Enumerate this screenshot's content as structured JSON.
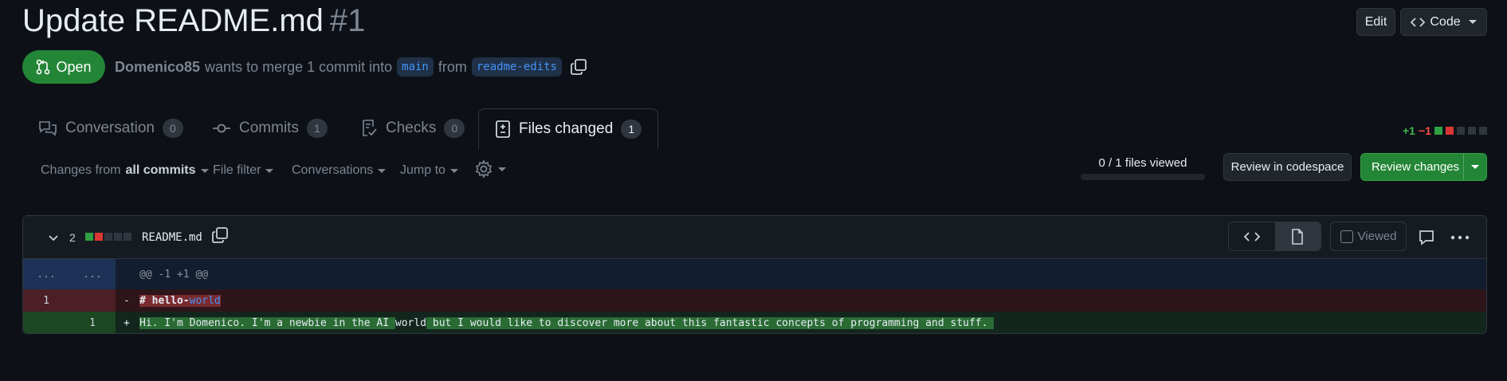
{
  "pr": {
    "title": "Update README.md",
    "number": "#1",
    "status": "Open",
    "author": "Domenico85",
    "merge_text": "wants to merge 1 commit into",
    "base_branch": "main",
    "from_text": "from",
    "head_branch": "readme-edits"
  },
  "header_buttons": {
    "edit": "Edit",
    "code": "Code"
  },
  "tabs": [
    {
      "label": "Conversation",
      "count": "0"
    },
    {
      "label": "Commits",
      "count": "1"
    },
    {
      "label": "Checks",
      "count": "0"
    },
    {
      "label": "Files changed",
      "count": "1"
    }
  ],
  "diffstat": {
    "additions": "+1",
    "deletions": "−1"
  },
  "toolbar": {
    "changes_from": "Changes from",
    "all_commits": "all commits",
    "file_filter": "File filter",
    "conversations": "Conversations",
    "jump_to": "Jump to",
    "files_viewed": "0 / 1 files viewed",
    "review_codespace": "Review in codespace",
    "review_changes": "Review changes"
  },
  "file": {
    "changes_count": "2",
    "name": "README.md",
    "viewed_label": "Viewed",
    "hunk_ln": "...",
    "hunk_header": "@@ -1 +1 @@",
    "deleted_line": {
      "old_ln": "1",
      "sign": "-",
      "part1": "# hello-",
      "part2": "world"
    },
    "added_line": {
      "new_ln": "1",
      "sign": "+",
      "part1": "Hi. I'm Domenico. I'm a newbie in the AI ",
      "part2": "world",
      "part3": " but I would like to discover more about this fantastic concepts of programming and stuff. "
    }
  },
  "colors": {
    "accent_green": "#238636",
    "link_blue": "#4493f8",
    "deletion_red": "#f85149",
    "addition_green": "#3fb950"
  }
}
